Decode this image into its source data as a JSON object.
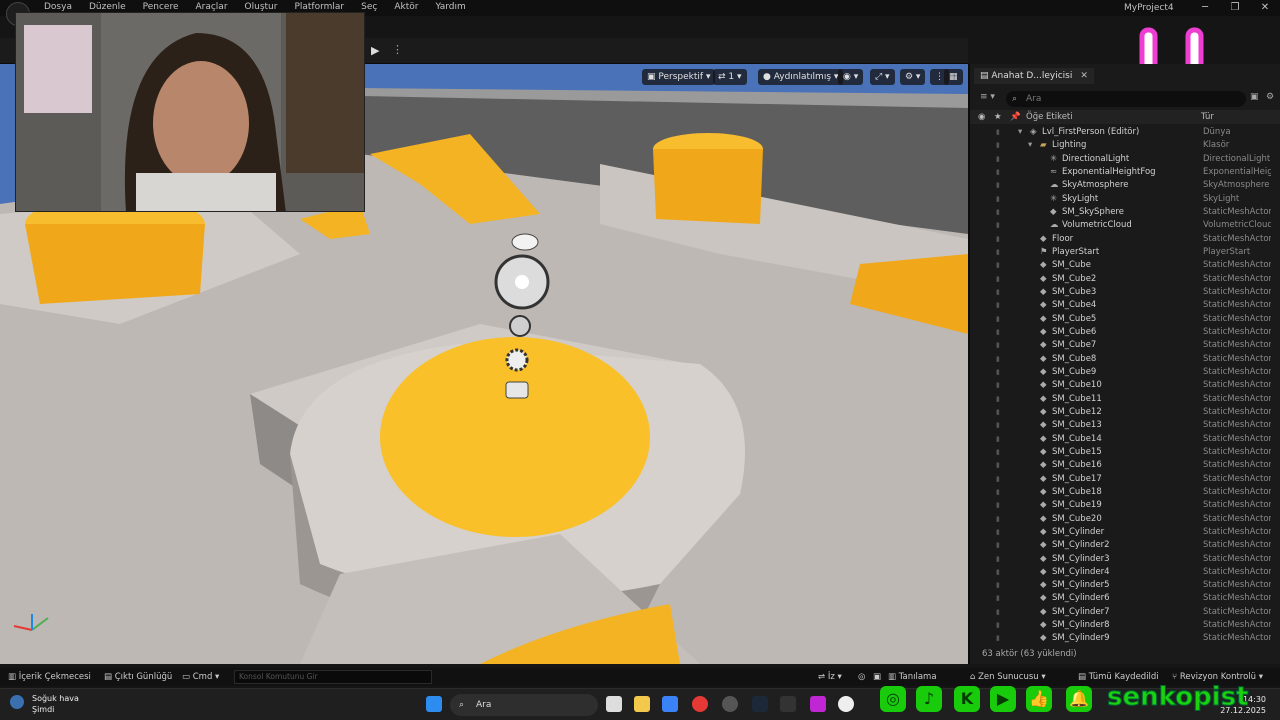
{
  "menubar": {
    "items": [
      "Dosya",
      "Düzenle",
      "Pencere",
      "Araçlar",
      "Oluştur",
      "Platformlar",
      "Seç",
      "Aktör",
      "Yardım"
    ],
    "project": "MyProject4",
    "window_controls": [
      "─",
      "❐",
      "✕"
    ]
  },
  "viewport": {
    "perspective": "Perspektif",
    "camera_speed": "1",
    "view_mode": "Aydınlatılmış"
  },
  "outliner": {
    "tab_title": "Anahat D...leyicisi",
    "search_placeholder": "Ara",
    "header_label": "Öğe Etiketi",
    "header_type": "Tür",
    "rows": [
      {
        "name": "Lvl_FirstPerson (Editör)",
        "type": "Dünya",
        "depth": 0,
        "kind": "world"
      },
      {
        "name": "Lighting",
        "type": "Klasör",
        "depth": 1,
        "kind": "folder"
      },
      {
        "name": "DirectionalLight",
        "type": "DirectionalLight",
        "depth": 2,
        "kind": "light"
      },
      {
        "name": "ExponentialHeightFog",
        "type": "ExponentialHeigh",
        "depth": 2,
        "kind": "fog"
      },
      {
        "name": "SkyAtmosphere",
        "type": "SkyAtmosphere",
        "depth": 2,
        "kind": "sky"
      },
      {
        "name": "SkyLight",
        "type": "SkyLight",
        "depth": 2,
        "kind": "light"
      },
      {
        "name": "SM_SkySphere",
        "type": "StaticMeshActor",
        "depth": 2,
        "kind": "mesh"
      },
      {
        "name": "VolumetricCloud",
        "type": "VolumetricCloud",
        "depth": 2,
        "kind": "cloud"
      },
      {
        "name": "Floor",
        "type": "StaticMeshActor",
        "depth": 1,
        "kind": "mesh"
      },
      {
        "name": "PlayerStart",
        "type": "PlayerStart",
        "depth": 1,
        "kind": "player"
      },
      {
        "name": "SM_Cube",
        "type": "StaticMeshActor",
        "depth": 1,
        "kind": "mesh"
      },
      {
        "name": "SM_Cube2",
        "type": "StaticMeshActor",
        "depth": 1,
        "kind": "mesh"
      },
      {
        "name": "SM_Cube3",
        "type": "StaticMeshActor",
        "depth": 1,
        "kind": "mesh"
      },
      {
        "name": "SM_Cube4",
        "type": "StaticMeshActor",
        "depth": 1,
        "kind": "mesh"
      },
      {
        "name": "SM_Cube5",
        "type": "StaticMeshActor",
        "depth": 1,
        "kind": "mesh"
      },
      {
        "name": "SM_Cube6",
        "type": "StaticMeshActor",
        "depth": 1,
        "kind": "mesh"
      },
      {
        "name": "SM_Cube7",
        "type": "StaticMeshActor",
        "depth": 1,
        "kind": "mesh"
      },
      {
        "name": "SM_Cube8",
        "type": "StaticMeshActor",
        "depth": 1,
        "kind": "mesh"
      },
      {
        "name": "SM_Cube9",
        "type": "StaticMeshActor",
        "depth": 1,
        "kind": "mesh"
      },
      {
        "name": "SM_Cube10",
        "type": "StaticMeshActor",
        "depth": 1,
        "kind": "mesh"
      },
      {
        "name": "SM_Cube11",
        "type": "StaticMeshActor",
        "depth": 1,
        "kind": "mesh"
      },
      {
        "name": "SM_Cube12",
        "type": "StaticMeshActor",
        "depth": 1,
        "kind": "mesh"
      },
      {
        "name": "SM_Cube13",
        "type": "StaticMeshActor",
        "depth": 1,
        "kind": "mesh"
      },
      {
        "name": "SM_Cube14",
        "type": "StaticMeshActor",
        "depth": 1,
        "kind": "mesh"
      },
      {
        "name": "SM_Cube15",
        "type": "StaticMeshActor",
        "depth": 1,
        "kind": "mesh"
      },
      {
        "name": "SM_Cube16",
        "type": "StaticMeshActor",
        "depth": 1,
        "kind": "mesh"
      },
      {
        "name": "SM_Cube17",
        "type": "StaticMeshActor",
        "depth": 1,
        "kind": "mesh"
      },
      {
        "name": "SM_Cube18",
        "type": "StaticMeshActor",
        "depth": 1,
        "kind": "mesh"
      },
      {
        "name": "SM_Cube19",
        "type": "StaticMeshActor",
        "depth": 1,
        "kind": "mesh"
      },
      {
        "name": "SM_Cube20",
        "type": "StaticMeshActor",
        "depth": 1,
        "kind": "mesh"
      },
      {
        "name": "SM_Cylinder",
        "type": "StaticMeshActor",
        "depth": 1,
        "kind": "mesh"
      },
      {
        "name": "SM_Cylinder2",
        "type": "StaticMeshActor",
        "depth": 1,
        "kind": "mesh"
      },
      {
        "name": "SM_Cylinder3",
        "type": "StaticMeshActor",
        "depth": 1,
        "kind": "mesh"
      },
      {
        "name": "SM_Cylinder4",
        "type": "StaticMeshActor",
        "depth": 1,
        "kind": "mesh"
      },
      {
        "name": "SM_Cylinder5",
        "type": "StaticMeshActor",
        "depth": 1,
        "kind": "mesh"
      },
      {
        "name": "SM_Cylinder6",
        "type": "StaticMeshActor",
        "depth": 1,
        "kind": "mesh"
      },
      {
        "name": "SM_Cylinder7",
        "type": "StaticMeshActor",
        "depth": 1,
        "kind": "mesh"
      },
      {
        "name": "SM_Cylinder8",
        "type": "StaticMeshActor",
        "depth": 1,
        "kind": "mesh"
      },
      {
        "name": "SM_Cylinder9",
        "type": "StaticMeshActor",
        "depth": 1,
        "kind": "mesh"
      }
    ],
    "footer": "63 aktör (63 yüklendi)"
  },
  "bottombar": {
    "content_drawer": "İçerik Çekmecesi",
    "output_log": "Çıktı Günlüğü",
    "cmd": "Cmd",
    "cmd_placeholder": "Konsol Komutunu Gir",
    "trace": "İz",
    "derive": "Tanılama",
    "zen": "Zen Sunucusu",
    "save_all": "Tümü Kaydedildi",
    "revision": "Revizyon Kontrolü"
  },
  "taskbar": {
    "weather_title": "Soğuk hava",
    "weather_sub": "Şimdi",
    "search": "Ara",
    "time": "14:30",
    "date": "27.12.2025"
  },
  "overlay": {
    "brand": "senkopist",
    "brand_color": "#1ad20e"
  },
  "colors": {
    "accent_yellow": "#f5b01c",
    "sky": "#4a72b8",
    "smiley": "#ee3ed2"
  }
}
